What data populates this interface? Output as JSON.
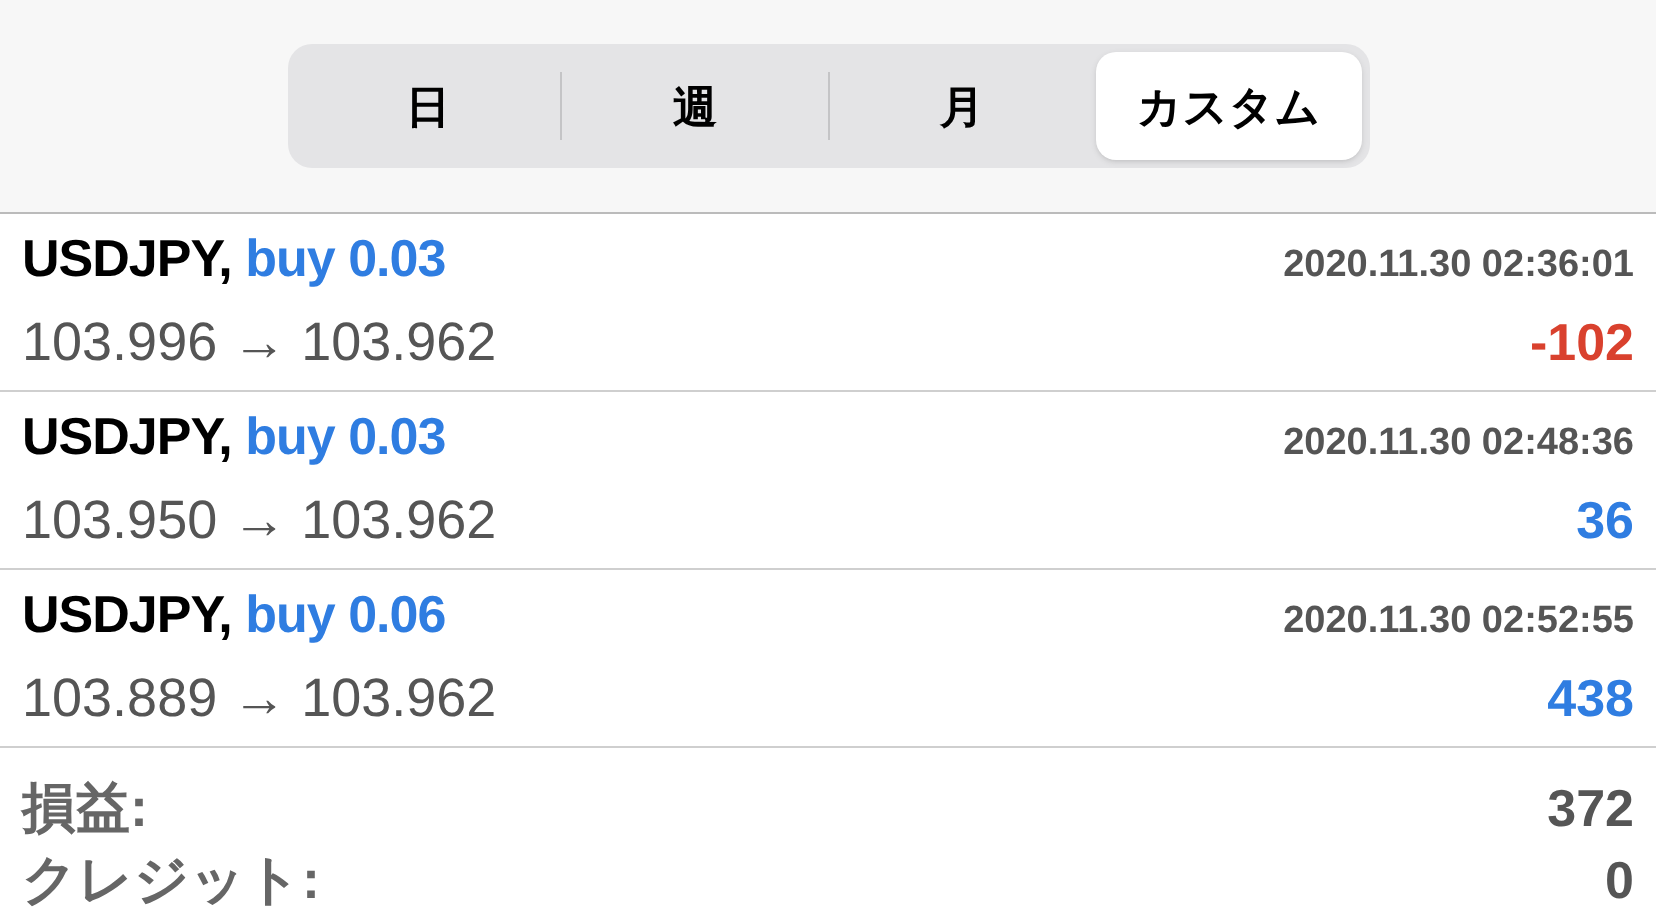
{
  "period_tabs": [
    {
      "label": "日",
      "selected": false
    },
    {
      "label": "週",
      "selected": false
    },
    {
      "label": "月",
      "selected": false
    },
    {
      "label": "カスタム",
      "selected": true
    }
  ],
  "deals": [
    {
      "symbol": "USDJPY,",
      "side": "buy 0.03",
      "time": "2020.11.30 02:36:01",
      "prices": "103.996 → 103.962",
      "profit": "-102",
      "color": "#d9412e"
    },
    {
      "symbol": "USDJPY,",
      "side": "buy 0.03",
      "time": "2020.11.30 02:48:36",
      "prices": "103.950 → 103.962",
      "profit": "36",
      "color": "#2f7de1"
    },
    {
      "symbol": "USDJPY,",
      "side": "buy 0.06",
      "time": "2020.11.30 02:52:55",
      "prices": "103.889 → 103.962",
      "profit": "438",
      "color": "#2f7de1"
    }
  ],
  "summary": [
    {
      "label": "損益:",
      "value": "372"
    },
    {
      "label": "クレジット:",
      "value": "0"
    }
  ]
}
